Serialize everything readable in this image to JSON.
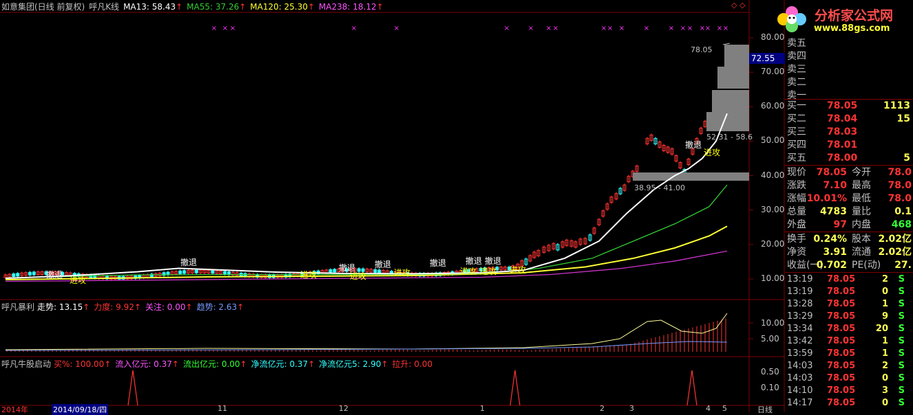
{
  "header": {
    "stock": "如意集团(日线 前复权)",
    "indicator": "呼凡K线",
    "ma13": "MA13: 58.43",
    "ma55": "MA55: 37.26",
    "ma120": "MA120: 25.30",
    "ma238": "MA238: 18.12",
    "arrow": "↑",
    "marks": "◇ ◇"
  },
  "sub1": {
    "name": "呼凡暴利",
    "trend": "走势: 13.15",
    "force": "力度: 9.92",
    "focus": "关注: 0.00",
    "tendency": "趋势: 2.63",
    "arrow": "↑"
  },
  "sub2": {
    "name": "呼凡牛股启动",
    "buy": "买%: 100.00",
    "inflow": "流入亿元: 0.37",
    "outflow": "流出亿元: 0.00",
    "netflow": "净流亿元: 0.37",
    "netflow5": "净流亿元5: 2.90",
    "lift": "拉升: 0.00",
    "arrow": "↑"
  },
  "yaxis_main": [
    "80.00",
    "70.00",
    "60.00",
    "50.00",
    "40.00",
    "30.00",
    "20.00",
    "10.00"
  ],
  "yaxis_sub1": [
    "10.00",
    "5.00"
  ],
  "yaxis_sub2": [
    "0.50",
    "0.10"
  ],
  "current_price_tag": "72.55",
  "price_labels": {
    "high": "78.05",
    "zone_upper": "52.31 - 58.6",
    "zone_lower": "38.95 - 41.00"
  },
  "signals": {
    "retreat": "撤退",
    "attack": "进攻"
  },
  "xaxis": {
    "year": "2014年",
    "date": "2014/09/18/四",
    "months": [
      "11",
      "12",
      "1",
      "2",
      "3",
      "4",
      "5"
    ],
    "period": "日线"
  },
  "logo": {
    "name": "分析家公式网",
    "url": "www.88gs.com"
  },
  "order_book": {
    "sell": [
      {
        "label": "卖五",
        "price": "",
        "vol": ""
      },
      {
        "label": "卖四",
        "price": "",
        "vol": ""
      },
      {
        "label": "卖三",
        "price": "",
        "vol": ""
      },
      {
        "label": "卖二",
        "price": "",
        "vol": ""
      },
      {
        "label": "卖一",
        "price": "",
        "vol": ""
      }
    ],
    "buy": [
      {
        "label": "买一",
        "price": "78.05",
        "vol": "1113"
      },
      {
        "label": "买二",
        "price": "78.04",
        "vol": "15"
      },
      {
        "label": "买三",
        "price": "78.03",
        "vol": ""
      },
      {
        "label": "买四",
        "price": "78.01",
        "vol": ""
      },
      {
        "label": "买五",
        "price": "78.00",
        "vol": "5"
      }
    ]
  },
  "stats": [
    {
      "l1": "现价",
      "v1": "78.05",
      "c1": "#ff3333",
      "l2": "今开",
      "v2": "78.0",
      "c2": "#ff3333"
    },
    {
      "l1": "涨跌",
      "v1": "7.10",
      "c1": "#ff3333",
      "l2": "最高",
      "v2": "78.0",
      "c2": "#ff3333"
    },
    {
      "l1": "涨幅",
      "v1": "10.01%",
      "c1": "#ff3333",
      "l2": "最低",
      "v2": "78.0",
      "c2": "#ff3333"
    },
    {
      "l1": "总量",
      "v1": "4783",
      "c1": "#ffff55",
      "l2": "量比",
      "v2": "0.1",
      "c2": "#ffff55"
    },
    {
      "l1": "外盘",
      "v1": "97",
      "c1": "#ff3333",
      "l2": "内盘",
      "v2": "468",
      "c2": "#33ff33"
    }
  ],
  "stats2": [
    {
      "l1": "换手",
      "v1": "0.24%",
      "c1": "#ffff55",
      "l2": "股本",
      "v2": "2.02亿",
      "c2": "#ffff55"
    },
    {
      "l1": "净资",
      "v1": "3.91",
      "c1": "#ffff55",
      "l2": "流通",
      "v2": "2.02亿",
      "c2": "#ffff55"
    },
    {
      "l1": "收益(一)",
      "v1": "0.702",
      "c1": "#ffff55",
      "l2": "PE(动)",
      "v2": "27.",
      "c2": "#ffff55"
    }
  ],
  "ticks": [
    {
      "time": "13:19",
      "price": "78.05",
      "vol": "2",
      "flag": "S"
    },
    {
      "time": "13:19",
      "price": "78.05",
      "vol": "0",
      "flag": "S"
    },
    {
      "time": "13:28",
      "price": "78.05",
      "vol": "1",
      "flag": "S"
    },
    {
      "time": "13:29",
      "price": "78.05",
      "vol": "9",
      "flag": "S"
    },
    {
      "time": "13:34",
      "price": "78.05",
      "vol": "20",
      "flag": "S"
    },
    {
      "time": "13:42",
      "price": "78.05",
      "vol": "1",
      "flag": "S"
    },
    {
      "time": "13:59",
      "price": "78.05",
      "vol": "1",
      "flag": "S"
    },
    {
      "time": "14:03",
      "price": "78.05",
      "vol": "2",
      "flag": "S"
    },
    {
      "time": "14:03",
      "price": "78.05",
      "vol": "0",
      "flag": "S"
    },
    {
      "time": "14:10",
      "price": "78.05",
      "vol": "3",
      "flag": "S"
    },
    {
      "time": "14:17",
      "price": "78.05",
      "vol": "0",
      "flag": "S"
    }
  ],
  "colors": {
    "up": "#ff3333",
    "down": "#33ffff",
    "ma13": "#ffffff",
    "ma55": "#33cc33",
    "ma120": "#ffff33",
    "ma238": "#cc33cc",
    "grid": "#800000",
    "retreat": "#ffffff",
    "attack": "#ffff00"
  }
}
